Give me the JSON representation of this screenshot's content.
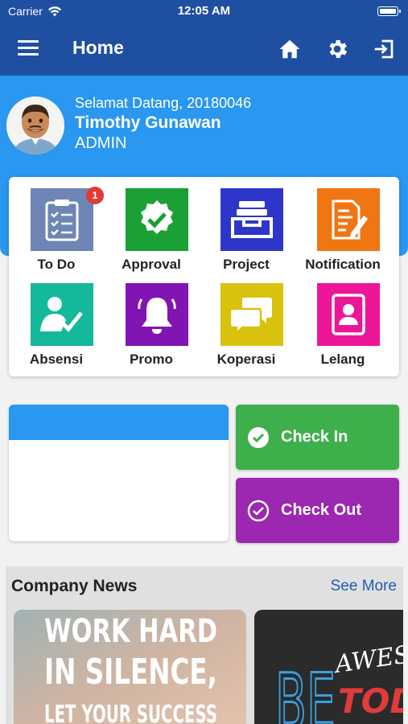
{
  "status": {
    "carrier": "Carrier",
    "time": "12:05 AM"
  },
  "nav": {
    "title": "Home"
  },
  "profile": {
    "welcome": "Selamat Datang, 20180046",
    "name": "Timothy Gunawan",
    "role": "ADMIN"
  },
  "menu": [
    {
      "label": "To Do",
      "color": "#6e86b5",
      "icon": "clipboard-icon",
      "badge": "1"
    },
    {
      "label": "Approval",
      "color": "#1aa035",
      "icon": "badge-check-icon"
    },
    {
      "label": "Project",
      "color": "#2d36c9",
      "icon": "file-tray-icon"
    },
    {
      "label": "Notification",
      "color": "#f07614",
      "icon": "document-edit-icon"
    },
    {
      "label": "Absensi",
      "color": "#14b89a",
      "icon": "person-check-icon"
    },
    {
      "label": "Promo",
      "color": "#8114b3",
      "icon": "bell-icon"
    },
    {
      "label": "Koperasi",
      "color": "#d9c20e",
      "icon": "chat-bubbles-icon"
    },
    {
      "label": "Lelang",
      "color": "#ec1699",
      "icon": "contact-book-icon"
    }
  ],
  "attendance": {
    "check_in": "Check In",
    "check_out": "Check Out",
    "check_in_color": "#3daf4b",
    "check_out_color": "#9c27b0"
  },
  "news": {
    "title": "Company News",
    "see_more": "See More",
    "cards": [
      {
        "lines": [
          "WORK HARD",
          "IN SILENCE,",
          "LET YOUR SUCCESS"
        ]
      },
      {
        "big": "BE",
        "script1": "AWES",
        "script2": "TOD"
      }
    ]
  }
}
